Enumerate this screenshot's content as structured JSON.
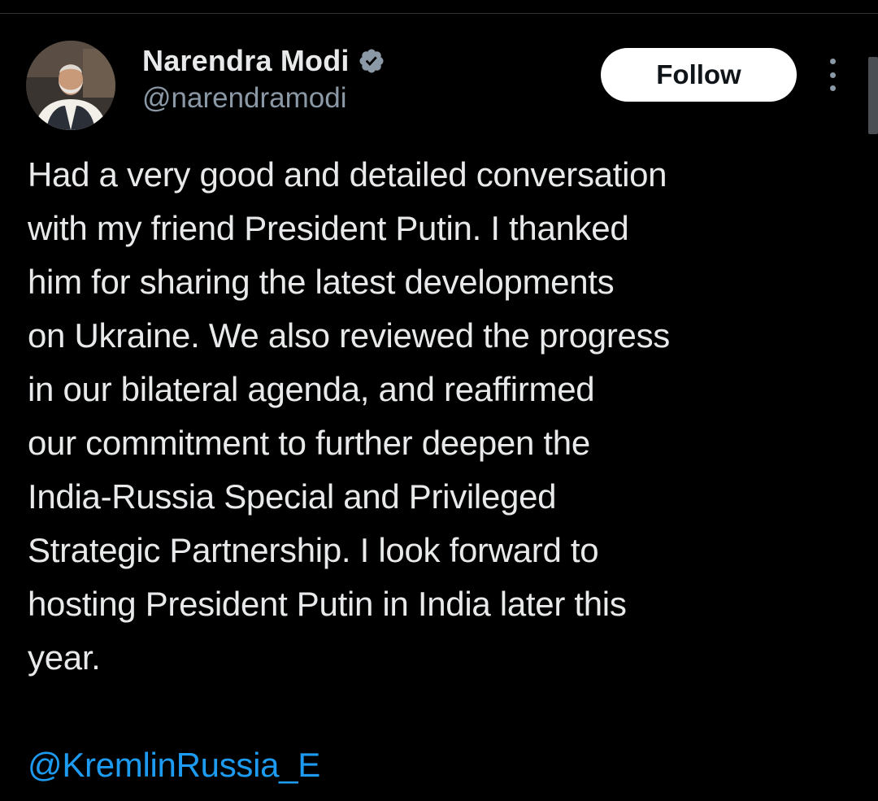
{
  "post": {
    "author": {
      "display_name": "Narendra Modi",
      "handle": "@narendramodi",
      "verified_icon": "verified-badge-icon",
      "avatar_icon": "avatar"
    },
    "follow_label": "Follow",
    "more_icon": "more-options-icon",
    "text": "Had a very good and detailed conversation\nwith my friend President Putin. I thanked\nhim for sharing the latest developments\non Ukraine. We also reviewed the progress\nin our bilateral agenda, and reaffirmed\nour commitment to further deepen the\nIndia-Russia Special and Privileged\nStrategic Partnership. I look forward to\nhosting President Putin in India later this\nyear.",
    "mention": "@KremlinRussia_E"
  },
  "colors": {
    "background": "#000000",
    "text_primary": "#e7e9ea",
    "text_secondary": "#8b98a5",
    "link": "#1d9bf0",
    "follow_button_bg": "#ffffff",
    "follow_button_text": "#0f1419"
  }
}
